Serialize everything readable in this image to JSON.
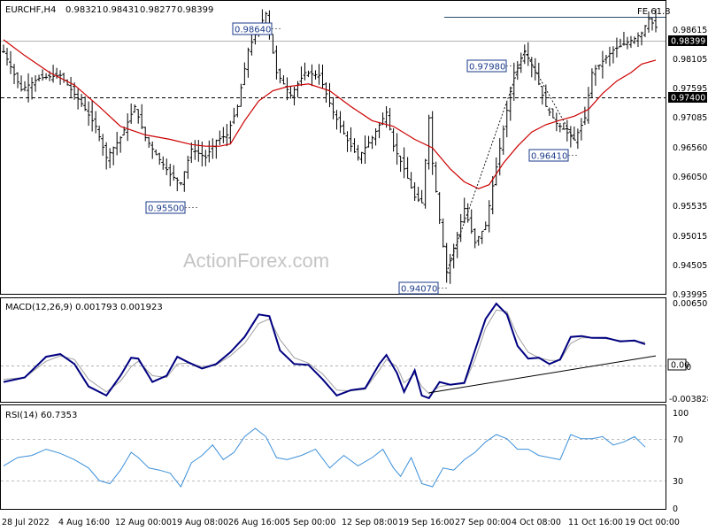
{
  "chart_data": [
    {
      "type": "ohlc",
      "header": {
        "symbol": "EURCHF,H4",
        "open": "0.98321",
        "high": "0.98431",
        "low": "0.98277",
        "close": "0.98399"
      },
      "watermark": "ActionForex.com",
      "ylim": [
        0.9371,
        0.9885
      ],
      "y_ticks": [
        "0.98615",
        "0.98105",
        "0.97595",
        "0.97085",
        "0.96560",
        "0.96050",
        "0.95535",
        "0.95015",
        "0.94505",
        "0.93995"
      ],
      "last_price": "0.98399",
      "horizontal_lines": [
        {
          "value": 0.974,
          "label": "0.97400",
          "style": "dashed"
        },
        {
          "value": 0.9835,
          "label": "",
          "style": "solid"
        }
      ],
      "fib_extension": {
        "label": "FE 61.8",
        "value": 0.9868
      },
      "annotations": [
        {
          "text": "0.98640",
          "value": 0.9864
        },
        {
          "text": "0.95500",
          "value": 0.955
        },
        {
          "text": "0.94070",
          "value": 0.9407
        },
        {
          "text": "0.97980",
          "value": 0.9798
        },
        {
          "text": "0.96410",
          "value": 0.9641
        }
      ],
      "moving_average_color": "#cc0000",
      "bar_color": "#000000",
      "x_tick_labels": [
        "28 Jul 2022",
        "4 Aug 16:00",
        "12 Aug 00:00",
        "19 Aug 08:00",
        "26 Aug 16:00",
        "5 Sep 00:00",
        "12 Sep 08:00",
        "19 Sep 16:00",
        "27 Sep 00:00",
        "4 Oct 08:00",
        "11 Oct 16:00",
        "19 Oct 00:00"
      ],
      "price_path": [
        [
          0,
          0.9797
        ],
        [
          5,
          0.973
        ],
        [
          10,
          0.975
        ],
        [
          16,
          0.9755
        ],
        [
          22,
          0.9705
        ],
        [
          26,
          0.9665
        ],
        [
          29,
          0.961
        ],
        [
          33,
          0.9645
        ],
        [
          37,
          0.97
        ],
        [
          40,
          0.9645
        ],
        [
          43,
          0.9615
        ],
        [
          47,
          0.958
        ],
        [
          50,
          0.9565
        ],
        [
          53,
          0.9625
        ],
        [
          57,
          0.961
        ],
        [
          60,
          0.964
        ],
        [
          63,
          0.965
        ],
        [
          66,
          0.97
        ],
        [
          69,
          0.98
        ],
        [
          72,
          0.984
        ],
        [
          74,
          0.9864
        ],
        [
          77,
          0.976
        ],
        [
          81,
          0.972
        ],
        [
          85,
          0.976
        ],
        [
          89,
          0.9755
        ],
        [
          93,
          0.969
        ],
        [
          97,
          0.964
        ],
        [
          100,
          0.961
        ],
        [
          104,
          0.9645
        ],
        [
          108,
          0.969
        ],
        [
          110,
          0.963
        ],
        [
          113,
          0.959
        ],
        [
          116,
          0.954
        ],
        [
          118,
          0.953
        ],
        [
          120,
          0.968
        ],
        [
          121,
          0.96
        ],
        [
          123,
          0.95
        ],
        [
          125,
          0.9407
        ],
        [
          127,
          0.945
        ],
        [
          130,
          0.952
        ],
        [
          133,
          0.946
        ],
        [
          136,
          0.949
        ],
        [
          138,
          0.956
        ],
        [
          141,
          0.966
        ],
        [
          144,
          0.976
        ],
        [
          147,
          0.9798
        ],
        [
          150,
          0.976
        ],
        [
          153,
          0.97
        ],
        [
          156,
          0.967
        ],
        [
          158,
          0.966
        ],
        [
          161,
          0.9641
        ],
        [
          164,
          0.968
        ],
        [
          166,
          0.976
        ],
        [
          169,
          0.978
        ],
        [
          172,
          0.98
        ],
        [
          175,
          0.981
        ],
        [
          178,
          0.982
        ],
        [
          180,
          0.983
        ],
        [
          182,
          0.9855
        ],
        [
          184,
          0.984
        ]
      ],
      "moving_average_path": [
        [
          0,
          0.9818
        ],
        [
          6,
          0.979
        ],
        [
          13,
          0.976
        ],
        [
          20,
          0.9738
        ],
        [
          27,
          0.97
        ],
        [
          33,
          0.9665
        ],
        [
          40,
          0.965
        ],
        [
          47,
          0.9642
        ],
        [
          53,
          0.9633
        ],
        [
          57,
          0.963
        ],
        [
          61,
          0.963
        ],
        [
          64,
          0.9634
        ],
        [
          68,
          0.9675
        ],
        [
          72,
          0.971
        ],
        [
          76,
          0.9728
        ],
        [
          80,
          0.9735
        ],
        [
          86,
          0.974
        ],
        [
          92,
          0.9728
        ],
        [
          98,
          0.97
        ],
        [
          104,
          0.9675
        ],
        [
          110,
          0.9665
        ],
        [
          116,
          0.9642
        ],
        [
          121,
          0.9627
        ],
        [
          126,
          0.959
        ],
        [
          130,
          0.9567
        ],
        [
          134,
          0.9555
        ],
        [
          137,
          0.9562
        ],
        [
          141,
          0.96
        ],
        [
          145,
          0.963
        ],
        [
          149,
          0.9655
        ],
        [
          153,
          0.9668
        ],
        [
          157,
          0.9676
        ],
        [
          161,
          0.9683
        ],
        [
          165,
          0.9695
        ],
        [
          169,
          0.9723
        ],
        [
          173,
          0.9745
        ],
        [
          177,
          0.976
        ],
        [
          180,
          0.9775
        ],
        [
          184,
          0.9782
        ]
      ],
      "trendlines": [
        {
          "style": "dotted",
          "from": [
            125,
            0.9407
          ],
          "to": [
            147,
            0.9798
          ]
        },
        {
          "style": "dotted",
          "from": [
            147,
            0.9798
          ],
          "to": [
            161,
            0.9641
          ]
        }
      ]
    },
    {
      "type": "line",
      "title": "MACD(12,26,9) 0.001793 0.001923",
      "ylim": [
        -0.0046,
        0.0067
      ],
      "y_ticks": [
        "0.006509",
        "0.00",
        "-0.003828"
      ],
      "zero_box_label": "0.00",
      "series": [
        {
          "color": "#000080",
          "points": [
            [
              0,
              -0.0025
            ],
            [
              6,
              -0.002
            ],
            [
              12,
              0.0003
            ],
            [
              16,
              0.0006
            ],
            [
              20,
              -0.0005
            ],
            [
              24,
              -0.003
            ],
            [
              29,
              -0.004
            ],
            [
              33,
              -0.0018
            ],
            [
              36,
              0.0002
            ],
            [
              38,
              0.0001
            ],
            [
              42,
              -0.0025
            ],
            [
              46,
              -0.0018
            ],
            [
              49,
              0.0003
            ],
            [
              52,
              -0.0003
            ],
            [
              56,
              -0.001
            ],
            [
              60,
              -0.0005
            ],
            [
              64,
              0.0008
            ],
            [
              68,
              0.0025
            ],
            [
              72,
              0.005
            ],
            [
              75,
              0.0048
            ],
            [
              78,
              0.001
            ],
            [
              82,
              -0.0005
            ],
            [
              86,
              -0.0006
            ],
            [
              90,
              -0.0022
            ],
            [
              94,
              -0.004
            ],
            [
              98,
              -0.0034
            ],
            [
              102,
              -0.0032
            ],
            [
              106,
              -0.0005
            ],
            [
              108,
              0.0005
            ],
            [
              111,
              -0.0015
            ],
            [
              113,
              -0.0036
            ],
            [
              116,
              -0.0012
            ],
            [
              118,
              -0.004
            ],
            [
              120,
              -0.0043
            ],
            [
              123,
              -0.0025
            ],
            [
              126,
              -0.0028
            ],
            [
              130,
              -0.0026
            ],
            [
              133,
              0.001
            ],
            [
              136,
              0.0045
            ],
            [
              139,
              0.0062
            ],
            [
              142,
              0.005
            ],
            [
              145,
              0.0015
            ],
            [
              148,
              0.0001
            ],
            [
              151,
              0.0002
            ],
            [
              154,
              -0.0005
            ],
            [
              157,
              0.0
            ],
            [
              160,
              0.0025
            ],
            [
              163,
              0.0026
            ],
            [
              166,
              0.0024
            ],
            [
              170,
              0.0024
            ],
            [
              174,
              0.002
            ],
            [
              178,
              0.0021
            ],
            [
              181,
              0.0017
            ]
          ]
        },
        {
          "color": "#a0a0a0",
          "points": [
            [
              0,
              -0.0022
            ],
            [
              6,
              -0.002
            ],
            [
              12,
              -0.0002
            ],
            [
              16,
              0.0004
            ],
            [
              20,
              0.0
            ],
            [
              24,
              -0.0022
            ],
            [
              29,
              -0.0036
            ],
            [
              33,
              -0.0024
            ],
            [
              36,
              -0.0008
            ],
            [
              38,
              -0.0002
            ],
            [
              42,
              -0.0018
            ],
            [
              46,
              -0.002
            ],
            [
              49,
              -0.0005
            ],
            [
              52,
              -0.0004
            ],
            [
              56,
              -0.0008
            ],
            [
              60,
              -0.0006
            ],
            [
              64,
              0.0004
            ],
            [
              68,
              0.0018
            ],
            [
              72,
              0.004
            ],
            [
              75,
              0.0045
            ],
            [
              78,
              0.0022
            ],
            [
              82,
              0.0002
            ],
            [
              86,
              -0.0004
            ],
            [
              90,
              -0.0016
            ],
            [
              94,
              -0.0034
            ],
            [
              98,
              -0.0035
            ],
            [
              102,
              -0.0033
            ],
            [
              106,
              -0.0012
            ],
            [
              108,
              0.0
            ],
            [
              111,
              -0.0008
            ],
            [
              113,
              -0.0026
            ],
            [
              116,
              -0.0016
            ],
            [
              118,
              -0.003
            ],
            [
              120,
              -0.0038
            ],
            [
              123,
              -0.003
            ],
            [
              126,
              -0.0028
            ],
            [
              130,
              -0.0027
            ],
            [
              133,
              0.0
            ],
            [
              136,
              0.0035
            ],
            [
              139,
              0.0055
            ],
            [
              142,
              0.0053
            ],
            [
              145,
              0.0026
            ],
            [
              148,
              0.0008
            ],
            [
              151,
              0.0002
            ],
            [
              154,
              -0.0001
            ],
            [
              157,
              -0.0001
            ],
            [
              160,
              0.0018
            ],
            [
              163,
              0.0024
            ],
            [
              166,
              0.0024
            ],
            [
              170,
              0.0023
            ],
            [
              174,
              0.0021
            ],
            [
              178,
              0.002
            ],
            [
              181,
              0.0019
            ]
          ]
        }
      ],
      "trendline": {
        "from": [
          120,
          -0.0037
        ],
        "to": [
          184,
          0.0004
        ]
      }
    },
    {
      "type": "line",
      "title": "RSI(14) 60.7353",
      "ylim": [
        0,
        100
      ],
      "y_ticks": [
        "100",
        "70",
        "30",
        "0"
      ],
      "levels": [
        70,
        30
      ],
      "series": [
        {
          "color": "#3b8fd9",
          "points": [
            [
              0,
              42
            ],
            [
              4,
              50
            ],
            [
              8,
              52
            ],
            [
              12,
              58
            ],
            [
              16,
              54
            ],
            [
              20,
              48
            ],
            [
              24,
              40
            ],
            [
              27,
              28
            ],
            [
              30,
              25
            ],
            [
              33,
              38
            ],
            [
              36,
              55
            ],
            [
              38,
              50
            ],
            [
              41,
              40
            ],
            [
              44,
              38
            ],
            [
              47,
              35
            ],
            [
              50,
              22
            ],
            [
              53,
              45
            ],
            [
              56,
              52
            ],
            [
              59,
              62
            ],
            [
              62,
              48
            ],
            [
              65,
              55
            ],
            [
              68,
              70
            ],
            [
              71,
              78
            ],
            [
              74,
              70
            ],
            [
              77,
              50
            ],
            [
              80,
              48
            ],
            [
              84,
              52
            ],
            [
              88,
              58
            ],
            [
              92,
              40
            ],
            [
              96,
              52
            ],
            [
              100,
              42
            ],
            [
              104,
              50
            ],
            [
              107,
              58
            ],
            [
              110,
              40
            ],
            [
              112,
              32
            ],
            [
              115,
              50
            ],
            [
              118,
              25
            ],
            [
              121,
              22
            ],
            [
              124,
              40
            ],
            [
              127,
              38
            ],
            [
              130,
              48
            ],
            [
              133,
              55
            ],
            [
              136,
              65
            ],
            [
              139,
              72
            ],
            [
              142,
              68
            ],
            [
              145,
              58
            ],
            [
              148,
              58
            ],
            [
              151,
              52
            ],
            [
              154,
              50
            ],
            [
              157,
              48
            ],
            [
              160,
              72
            ],
            [
              163,
              68
            ],
            [
              166,
              68
            ],
            [
              169,
              70
            ],
            [
              172,
              62
            ],
            [
              175,
              65
            ],
            [
              178,
              70
            ],
            [
              181,
              60
            ]
          ]
        }
      ]
    }
  ]
}
